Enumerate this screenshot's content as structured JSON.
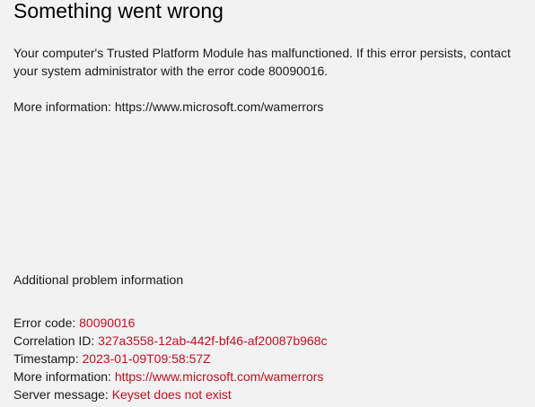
{
  "title": "Something went wrong",
  "message": "Your computer's Trusted Platform Module has malfunctioned. If this error persists, contact your system administrator with the error code 80090016.",
  "more_info": {
    "label": "More information:",
    "url": "https://www.microsoft.com/wamerrors"
  },
  "additional": {
    "heading": "Additional problem information",
    "error_code": {
      "label": "Error code:",
      "value": "80090016"
    },
    "correlation_id": {
      "label": "Correlation ID:",
      "value": "327a3558-12ab-442f-bf46-af20087b968c"
    },
    "timestamp": {
      "label": "Timestamp:",
      "value": "2023-01-09T09:58:57Z"
    },
    "more_information": {
      "label": "More information:",
      "value": "https://www.microsoft.com/wamerrors"
    },
    "server_message": {
      "label": "Server message:",
      "value": "Keyset does not exist"
    }
  },
  "colors": {
    "background": "#f2f2f2",
    "text": "#1a1a1a",
    "value_red": "#c50f1f"
  }
}
